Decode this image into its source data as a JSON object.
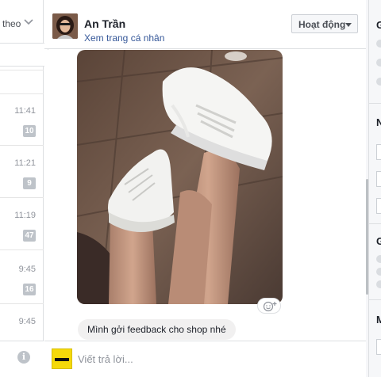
{
  "conversation_list": {
    "filter_label": "theo",
    "items": [
      {
        "time": "11:41",
        "unread": "10"
      },
      {
        "time": "11:21",
        "unread": "9"
      },
      {
        "time": "11:19",
        "unread": "47"
      },
      {
        "time": "9:45",
        "unread": "16"
      },
      {
        "time": "9:45",
        "unread": ""
      }
    ]
  },
  "header": {
    "contact_name": "An Trần",
    "profile_link": "Xem trang cá nhân",
    "status_button": "Hoạt động"
  },
  "thread": {
    "messages": [
      {
        "type": "photo",
        "description": "photo"
      },
      {
        "type": "text",
        "text": "Mình gởi feedback cho shop nhé"
      }
    ]
  },
  "reply": {
    "placeholder": "Viết trả lời..."
  },
  "right_panel": {
    "headings": [
      "G",
      "N",
      "G",
      "M"
    ]
  },
  "colors": {
    "link": "#365899",
    "bubble": "#f1f0f0",
    "badge": "#bec3c9",
    "page_logo": "#f5d90a"
  }
}
